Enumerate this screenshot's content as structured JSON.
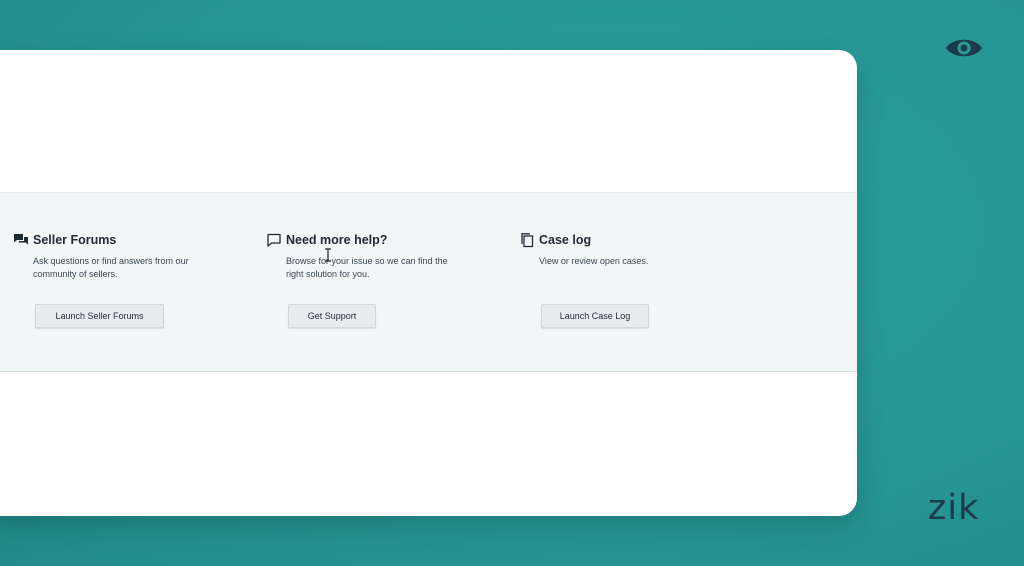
{
  "colors": {
    "background": "#2a9a98",
    "card": "#ffffff",
    "band": "#f1f6f7",
    "button": "#e9ecee",
    "text_dark": "#1f2b33",
    "logo": "#1d3a4a"
  },
  "help_sections": [
    {
      "icon": "forum-chat-icon",
      "title": "Seller Forums",
      "description": "Ask questions or find answers from our community of sellers.",
      "button_label": "Launch Seller Forums"
    },
    {
      "icon": "speech-bubble-icon",
      "title": "Need more help?",
      "description": "Browse for your issue so we can find the right solution for you.",
      "button_label": "Get Support"
    },
    {
      "icon": "copy-documents-icon",
      "title": "Case log",
      "description": "View or review open cases.",
      "button_label": "Launch Case Log"
    }
  ],
  "brand": {
    "logo_text": "zik",
    "eye_icon": "eye-icon"
  }
}
